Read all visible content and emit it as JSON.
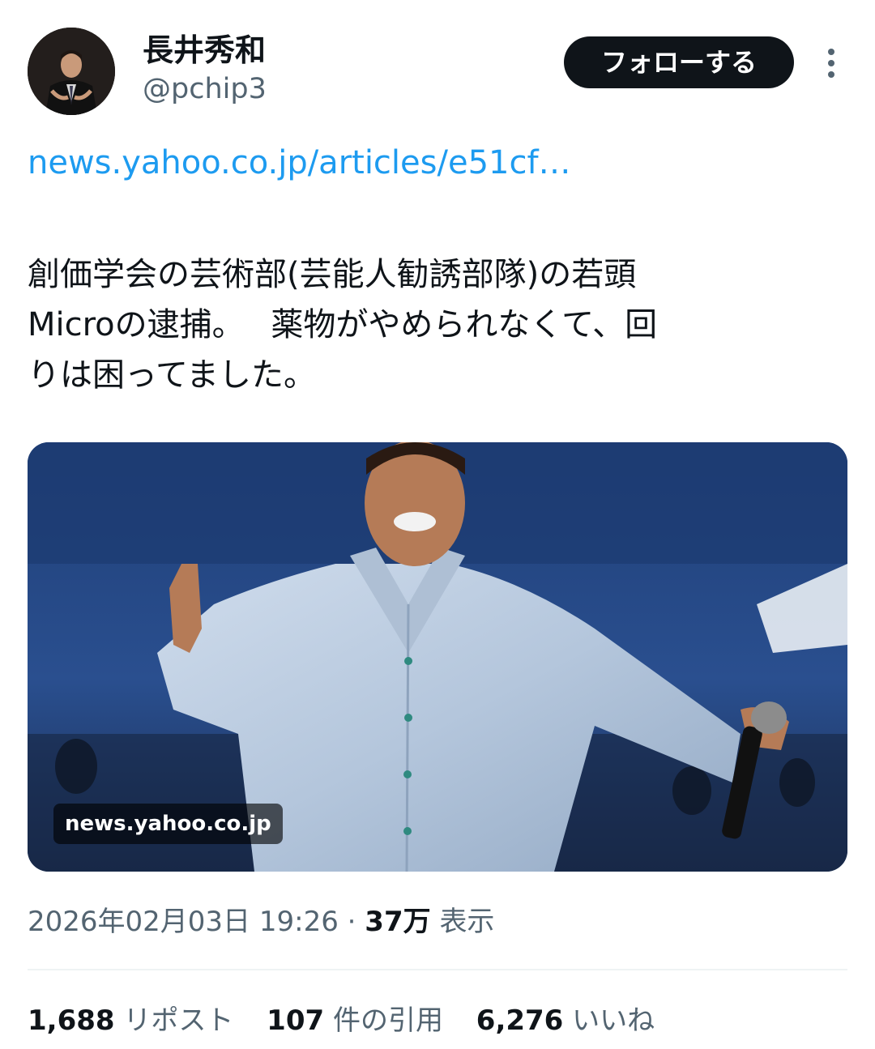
{
  "user": {
    "display_name": "長井秀和",
    "handle": "@pchip3",
    "follow_label": "フォローする",
    "more_icon": "more-vertical-icon"
  },
  "tweet": {
    "link_text": "news.yahoo.co.jp/articles/e51cf…",
    "text_lines": [
      "創価学会の芸術部(芸能人勧誘部隊)の若頭",
      "Microの逮捕。　 薬物がやめられなくて、回",
      "りは困ってました。"
    ]
  },
  "media": {
    "domain": "news.yahoo.co.jp"
  },
  "meta": {
    "timestamp": "2026年02月03日 19:26",
    "separator": "·",
    "views_count": "37万",
    "views_label": "表示"
  },
  "stats": {
    "reposts_count": "1,688",
    "reposts_label": "リポスト",
    "quotes_count": "107",
    "quotes_label": "件の引用",
    "likes_count": "6,276",
    "likes_label": "いいね"
  },
  "colors": {
    "link": "#1d9bf0",
    "secondary_text": "#536471",
    "primary_text": "#0f1419",
    "follow_button_bg": "#0f1419"
  }
}
